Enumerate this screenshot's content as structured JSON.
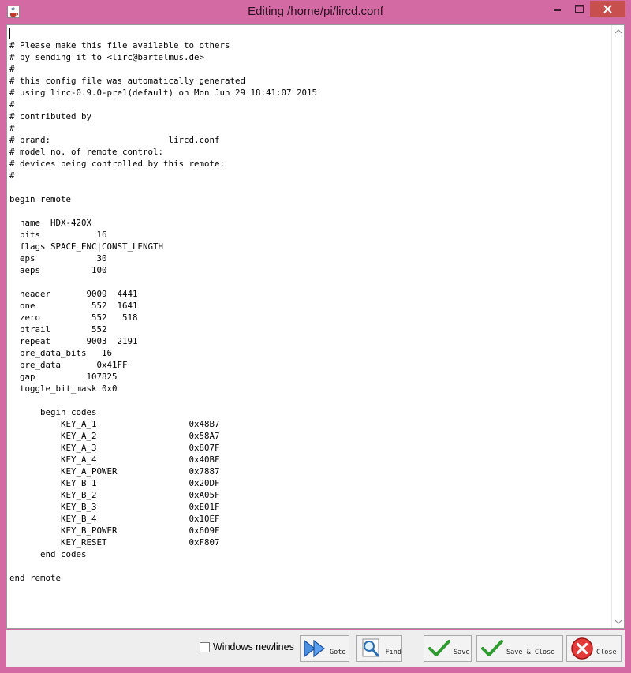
{
  "window": {
    "title": "Editing /home/pi/lircd.conf",
    "icon": "java-coffee-icon",
    "controls": [
      "minimize-icon",
      "maximize-icon",
      "close-icon"
    ],
    "accent_color": "#d36aa4",
    "close_color": "#c7504f"
  },
  "editor": {
    "lines": [
      "",
      "# Please make this file available to others",
      "# by sending it to <lirc@bartelmus.de>",
      "#",
      "# this config file was automatically generated",
      "# using lirc-0.9.0-pre1(default) on Mon Jun 29 18:41:07 2015",
      "#",
      "# contributed by",
      "#",
      "# brand:                       lircd.conf",
      "# model no. of remote control:",
      "# devices being controlled by this remote:",
      "#",
      "",
      "begin remote",
      "",
      "  name  HDX-420X",
      "  bits           16",
      "  flags SPACE_ENC|CONST_LENGTH",
      "  eps            30",
      "  aeps          100",
      "",
      "  header       9009  4441",
      "  one           552  1641",
      "  zero          552   518",
      "  ptrail        552",
      "  repeat       9003  2191",
      "  pre_data_bits   16",
      "  pre_data       0x41FF",
      "  gap          107825",
      "  toggle_bit_mask 0x0",
      "",
      "      begin codes",
      "          KEY_A_1                  0x48B7",
      "          KEY_A_2                  0x58A7",
      "          KEY_A_3                  0x807F",
      "          KEY_A_4                  0x40BF",
      "          KEY_A_POWER              0x7887",
      "          KEY_B_1                  0x20DF",
      "          KEY_B_2                  0xA05F",
      "          KEY_B_3                  0xE01F",
      "          KEY_B_4                  0x10EF",
      "          KEY_B_POWER              0x609F",
      "          KEY_RESET                0xF807",
      "      end codes",
      "",
      "end remote"
    ]
  },
  "toolbar": {
    "windows_newlines_label": "Windows newlines",
    "windows_newlines_checked": false,
    "goto_label": "Goto",
    "find_label": "Find",
    "save_label": "Save",
    "save_close_label": "Save & Close",
    "close_label": "Close"
  }
}
